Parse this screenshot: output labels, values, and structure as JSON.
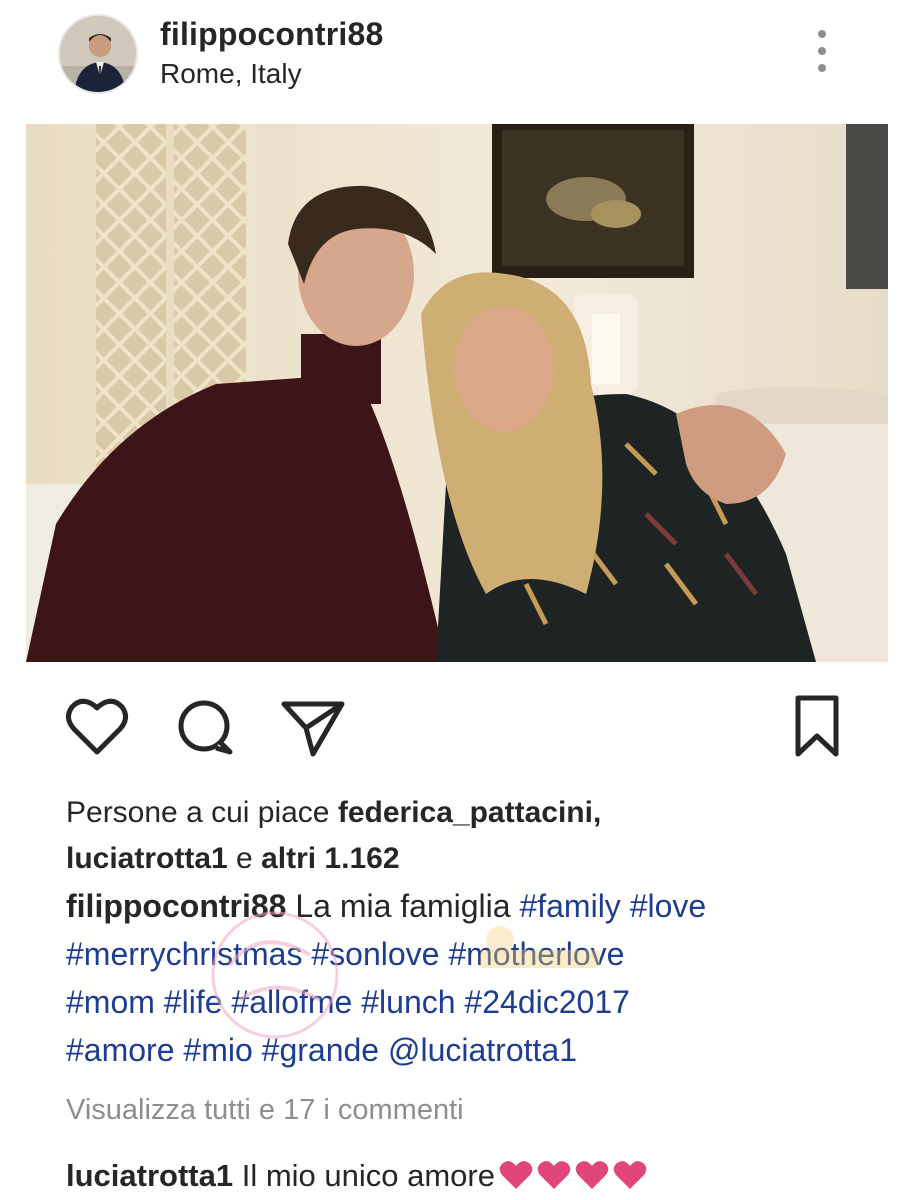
{
  "post": {
    "username": "filippocontri88",
    "location": "Rome, Italy"
  },
  "likes": {
    "prefix": "Persone a cui piace ",
    "user1": "federica_pattacini,",
    "user2": "luciatrotta1",
    "conj": " e ",
    "others": "altri 1.162"
  },
  "caption": {
    "username": "filippocontri88",
    "text": " La mia famiglia ",
    "tags": [
      "#family",
      "#love",
      "#merrychristmas",
      "#sonlove",
      "#motherlove",
      "#mom",
      "#life",
      "#allofme",
      "#lunch",
      "#24dic2017",
      "#amore",
      "#mio",
      "#grande"
    ],
    "mention": "@luciatrotta1"
  },
  "view_comments": "Visualizza tutti e 17 i commenti",
  "comment": {
    "username": "luciatrotta1",
    "text": " Il mio unico amore"
  },
  "icons": {
    "like": "heart-outline-icon",
    "comment": "speech-bubble-icon",
    "share": "paper-plane-icon",
    "save": "bookmark-icon",
    "more": "vertical-dots-icon"
  },
  "colors": {
    "tag": "#1d3d8f",
    "muted": "#8e8e8e",
    "heart_emoji": "#e0457b"
  }
}
